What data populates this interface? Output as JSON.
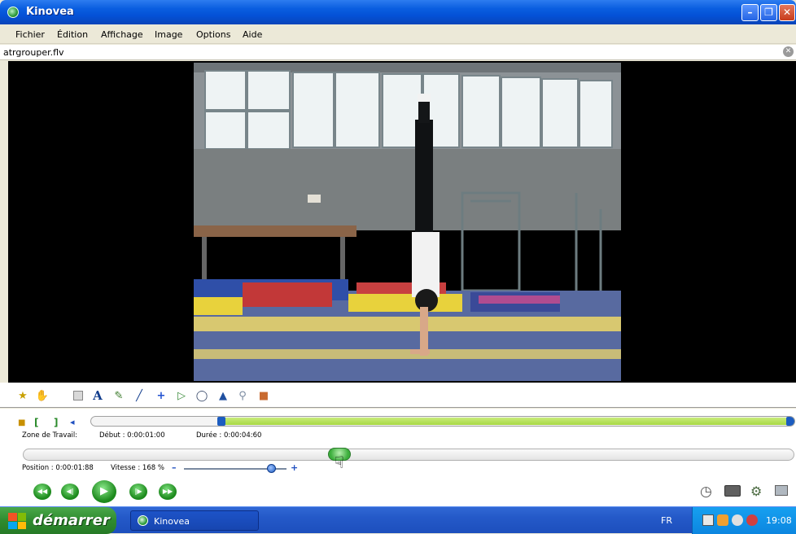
{
  "window": {
    "title": "Kinovea",
    "minimize_icon": "minimize-icon",
    "maximize_icon": "restore-icon",
    "close_icon": "close-icon"
  },
  "menu": [
    "Fichier",
    "Édition",
    "Affichage",
    "Image",
    "Options",
    "Aide"
  ],
  "file": {
    "name": "atrgrouper.flv"
  },
  "toolbar": {
    "text_tool": "A"
  },
  "workzone": {
    "label": "Zone de Travail:",
    "debut": "Début : 0:00:01:00",
    "duree": "Durée : 0:00:04:60",
    "selection_start": 0.185,
    "selection_end": 1.0
  },
  "playback": {
    "position": "Position : 0:00:01:88",
    "vitesse": "Vitesse : 168 %",
    "speed_fraction": 0.86,
    "position_fraction": 0.41
  },
  "taskbar": {
    "start_label": "démarrer",
    "task_label": "Kinovea",
    "language": "FR",
    "clock": "19:08"
  },
  "colors": {
    "accent_green": "#a8d844",
    "title_blue": "#0a5ee0",
    "start_green": "#2f8b2f"
  }
}
